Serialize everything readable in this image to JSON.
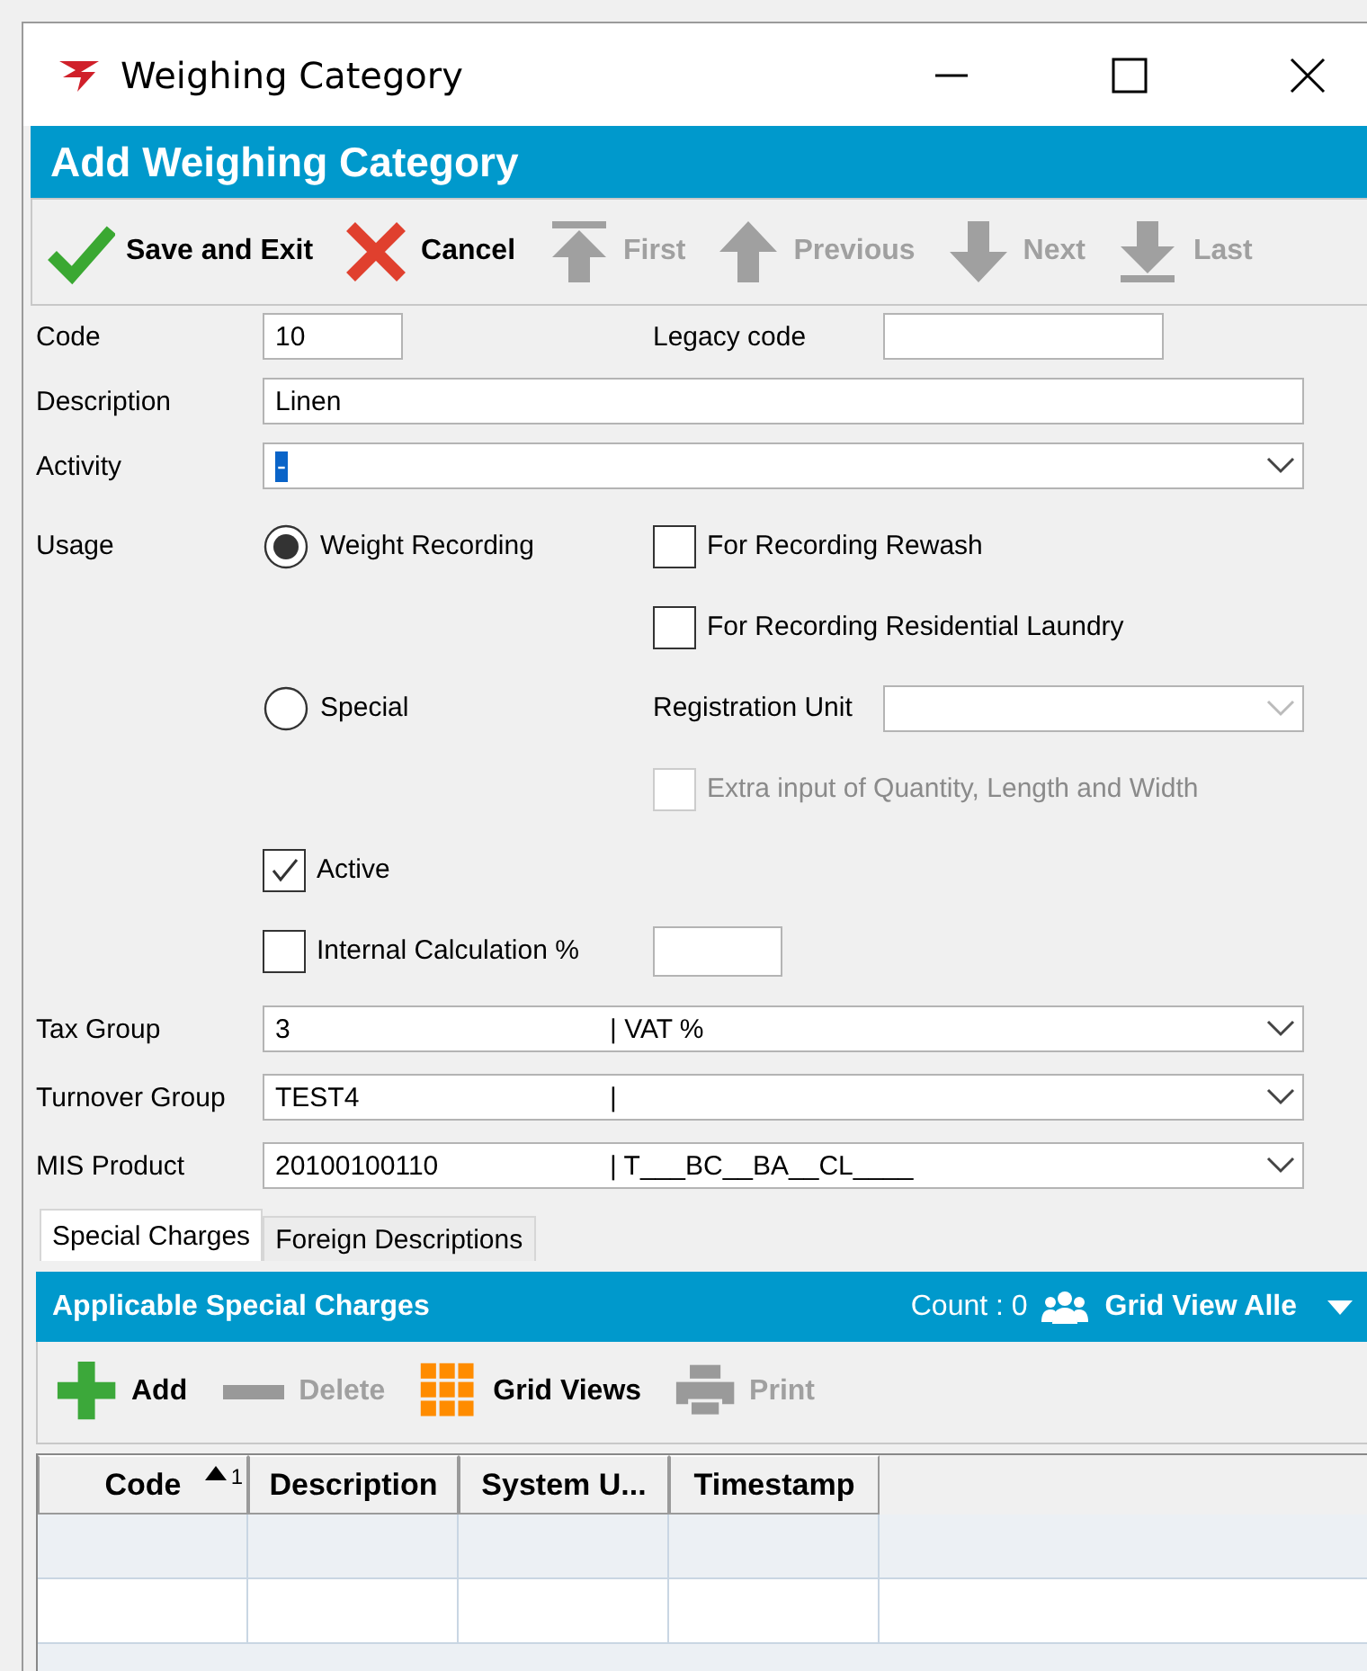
{
  "window": {
    "title": "Weighing Category"
  },
  "header": {
    "title": "Add Weighing Category"
  },
  "toolbar": [
    {
      "kind": "save",
      "label": "Save and Exit",
      "disabled": false
    },
    {
      "kind": "cancel",
      "label": "Cancel",
      "disabled": false
    },
    {
      "kind": "first",
      "label": "First",
      "disabled": true
    },
    {
      "kind": "previous",
      "label": "Previous",
      "disabled": true
    },
    {
      "kind": "next",
      "label": "Next",
      "disabled": true
    },
    {
      "kind": "last",
      "label": "Last",
      "disabled": true
    }
  ],
  "code": {
    "label": "Code",
    "value": "10"
  },
  "legacy_code": {
    "label": "Legacy code"
  },
  "description": {
    "label": "Description",
    "value": "Linen"
  },
  "activity": {
    "label": "Activity",
    "value": "-",
    "highlighted": true
  },
  "usage": {
    "label": "Usage",
    "radios": [
      {
        "label": "Weight Recording",
        "selected": true
      },
      {
        "label": "Special",
        "selected": false
      }
    ],
    "checkboxes": [
      {
        "label": "For Recording Rewash",
        "checked": false,
        "disabled": false
      },
      {
        "label": "For Recording Residential Laundry",
        "checked": false,
        "disabled": false
      },
      {
        "label": "Extra input of Quantity, Length and Width",
        "checked": false,
        "disabled": true
      }
    ],
    "registration_unit": {
      "label": "Registration Unit",
      "disabled": true
    }
  },
  "active": {
    "label": "Active",
    "checked": true
  },
  "internal_calculation": {
    "label": "Internal Calculation %",
    "checked": false
  },
  "lookups": [
    {
      "label": "Tax Group",
      "code": "3",
      "description": "| VAT %"
    },
    {
      "label": "Turnover Group",
      "code": "TEST4",
      "description": "|"
    },
    {
      "label": "MIS Product",
      "code": "20100100110",
      "description": "| T___BC__BA__CL____"
    }
  ],
  "tabs": [
    {
      "label": "Special Charges",
      "selected": true
    },
    {
      "label": "Foreign Descriptions",
      "selected": false
    }
  ],
  "grid_panel": {
    "title": "Applicable Special Charges",
    "count": "Count : 0",
    "grid_view": "Grid View Alle",
    "toolbar": [
      {
        "kind": "add",
        "label": "Add",
        "disabled": false
      },
      {
        "kind": "delete",
        "label": "Delete",
        "disabled": true
      },
      {
        "kind": "grid",
        "label": "Grid Views",
        "disabled": false
      },
      {
        "kind": "print",
        "label": "Print",
        "disabled": true
      }
    ],
    "columns": [
      {
        "label": "Code",
        "sorted": true,
        "sort_index": "1"
      },
      {
        "label": "Description",
        "sorted": false
      },
      {
        "label": "System U...",
        "sorted": false
      },
      {
        "label": "Timestamp",
        "sorted": false
      }
    ]
  }
}
